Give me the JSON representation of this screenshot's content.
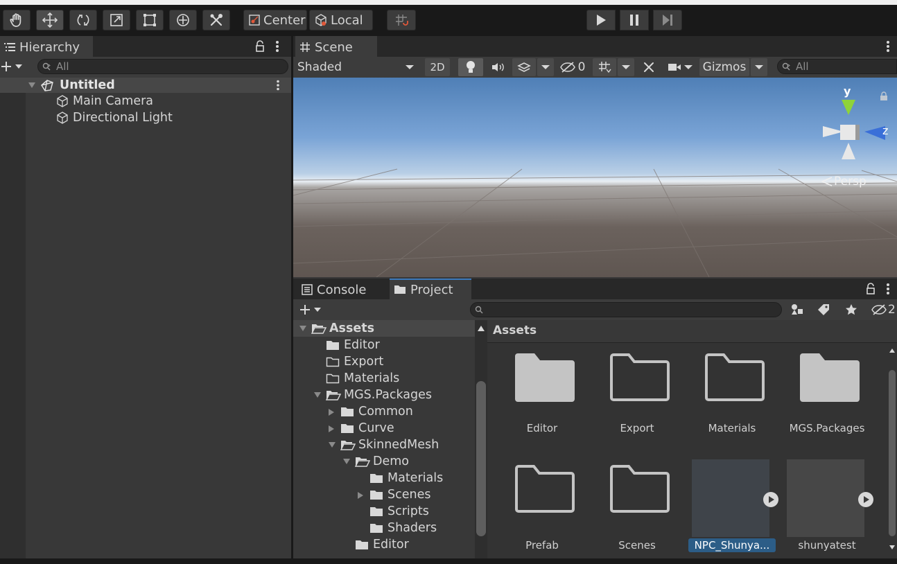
{
  "toolbar": {
    "tools": [
      "hand-tool",
      "move-tool",
      "rotate-tool",
      "scale-tool",
      "rect-tool",
      "transform-tool",
      "custom-tool"
    ],
    "pivot_label": "Center",
    "space_label": "Local"
  },
  "hierarchy": {
    "tab_label": "Hierarchy",
    "search_placeholder": "All",
    "scene_name": "Untitled",
    "items": [
      "Main Camera",
      "Directional Light"
    ]
  },
  "scene": {
    "tab_label": "Scene",
    "shading_mode": "Shaded",
    "btn_2d": "2D",
    "hidden_count": "0",
    "gizmos_label": "Gizmos",
    "search_placeholder": "All",
    "projection_label": "Persp",
    "axis_y": "y",
    "axis_z": "z"
  },
  "bottom": {
    "console_tab": "Console",
    "project_tab": "Project",
    "hidden_count": "2"
  },
  "project_tree": [
    {
      "label": "Assets",
      "level": 0,
      "expand": "open",
      "folder": "open"
    },
    {
      "label": "Editor",
      "level": 1,
      "expand": "none",
      "folder": "filled"
    },
    {
      "label": "Export",
      "level": 1,
      "expand": "none",
      "folder": "empty"
    },
    {
      "label": "Materials",
      "level": 1,
      "expand": "none",
      "folder": "empty"
    },
    {
      "label": "MGS.Packages",
      "level": 1,
      "expand": "open",
      "folder": "open"
    },
    {
      "label": "Common",
      "level": 2,
      "expand": "closed",
      "folder": "filled"
    },
    {
      "label": "Curve",
      "level": 2,
      "expand": "closed",
      "folder": "filled"
    },
    {
      "label": "SkinnedMesh",
      "level": 2,
      "expand": "open",
      "folder": "open"
    },
    {
      "label": "Demo",
      "level": 3,
      "expand": "open",
      "folder": "open"
    },
    {
      "label": "Materials",
      "level": 4,
      "expand": "none",
      "folder": "filled"
    },
    {
      "label": "Scenes",
      "level": 4,
      "expand": "closed",
      "folder": "filled"
    },
    {
      "label": "Scripts",
      "level": 4,
      "expand": "none",
      "folder": "filled"
    },
    {
      "label": "Shaders",
      "level": 4,
      "expand": "none",
      "folder": "filled"
    },
    {
      "label": "Editor",
      "level": 3,
      "expand": "none",
      "folder": "filled"
    }
  ],
  "project_grid": {
    "breadcrumb": "Assets",
    "items": [
      {
        "label": "Editor",
        "kind": "folder-filled"
      },
      {
        "label": "Export",
        "kind": "folder-empty"
      },
      {
        "label": "Materials",
        "kind": "folder-empty"
      },
      {
        "label": "MGS.Packages",
        "kind": "folder-filled"
      },
      {
        "label": "Prefab",
        "kind": "folder-empty"
      },
      {
        "label": "Scenes",
        "kind": "folder-empty"
      },
      {
        "label": "NPC_Shunya...",
        "kind": "prefab",
        "selected": true
      },
      {
        "label": "shunyatest",
        "kind": "prefab"
      }
    ]
  },
  "colors": {
    "accent": "#3a79bb",
    "selection": "#2c5d87",
    "panel": "#383838",
    "toolbar": "#191919"
  }
}
